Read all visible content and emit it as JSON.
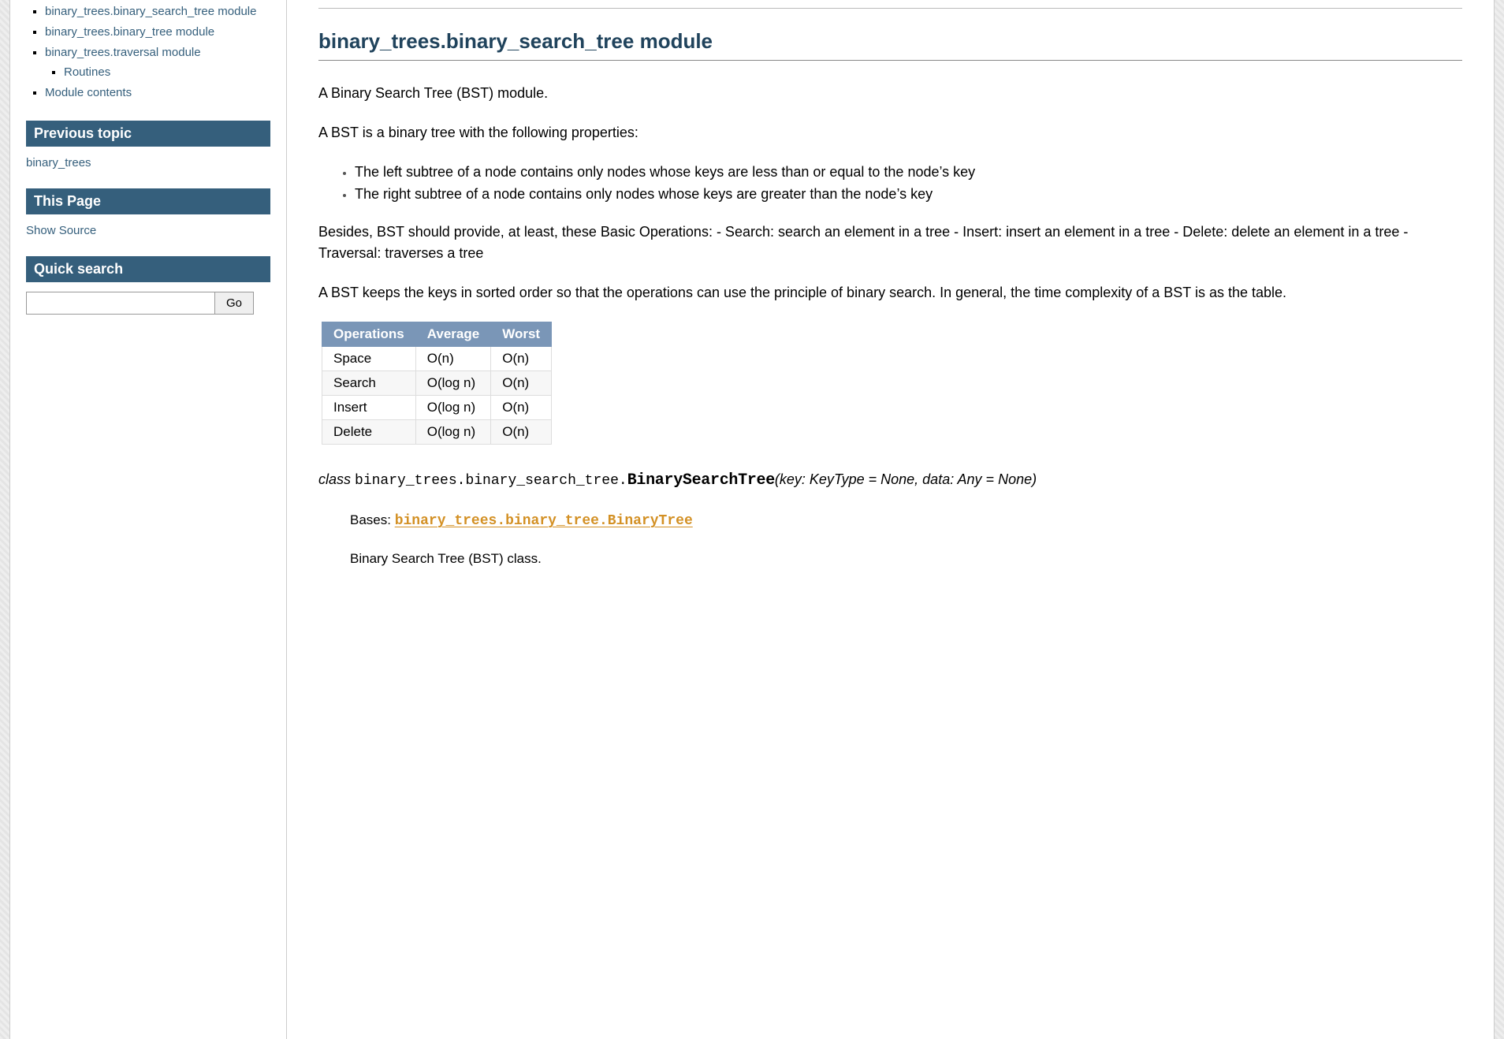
{
  "sidebar": {
    "nav": [
      {
        "label": "binary_trees.binary_search_tree module",
        "children": []
      },
      {
        "label": "binary_trees.binary_tree module",
        "children": []
      },
      {
        "label": "binary_trees.traversal module",
        "children": [
          {
            "label": "Routines"
          }
        ]
      },
      {
        "label": "Module contents",
        "children": []
      }
    ],
    "prev_heading": "Previous topic",
    "prev_link": "binary_trees",
    "thispage_heading": "This Page",
    "show_source": "Show Source",
    "quicksearch_heading": "Quick search",
    "go_label": "Go"
  },
  "main": {
    "h2": "binary_trees.binary_search_tree module",
    "p1": "A Binary Search Tree (BST) module.",
    "p2": "A BST is a binary tree with the following properties:",
    "bullets": [
      "The left subtree of a node contains only nodes whose keys are less than or equal to the node’s key",
      "The right subtree of a node contains only nodes whose keys are greater than the node’s key"
    ],
    "p3": "Besides, BST should provide, at least, these Basic Operations: - Search: search an element in a tree - Insert: insert an element in a tree - Delete: delete an element in a tree - Traversal: traverses a tree",
    "p4": "A BST keeps the keys in sorted order so that the operations can use the principle of binary search. In general, the time complexity of a BST is as the table.",
    "table": {
      "headers": [
        "Operations",
        "Average",
        "Worst"
      ],
      "rows": [
        [
          "Space",
          "O(n)",
          "O(n)"
        ],
        [
          "Search",
          "O(log n)",
          "O(n)"
        ],
        [
          "Insert",
          "O(log n)",
          "O(n)"
        ],
        [
          "Delete",
          "O(log n)",
          "O(n)"
        ]
      ]
    },
    "class_kw": "class",
    "prename": "binary_trees.binary_search_tree.",
    "descname": "BinarySearchTree",
    "sig_params": "(key: KeyType = None, data: Any = None)",
    "bases_label": "Bases: ",
    "bases_link": "binary_trees.binary_tree.BinaryTree",
    "class_desc": "Binary Search Tree (BST) class."
  }
}
